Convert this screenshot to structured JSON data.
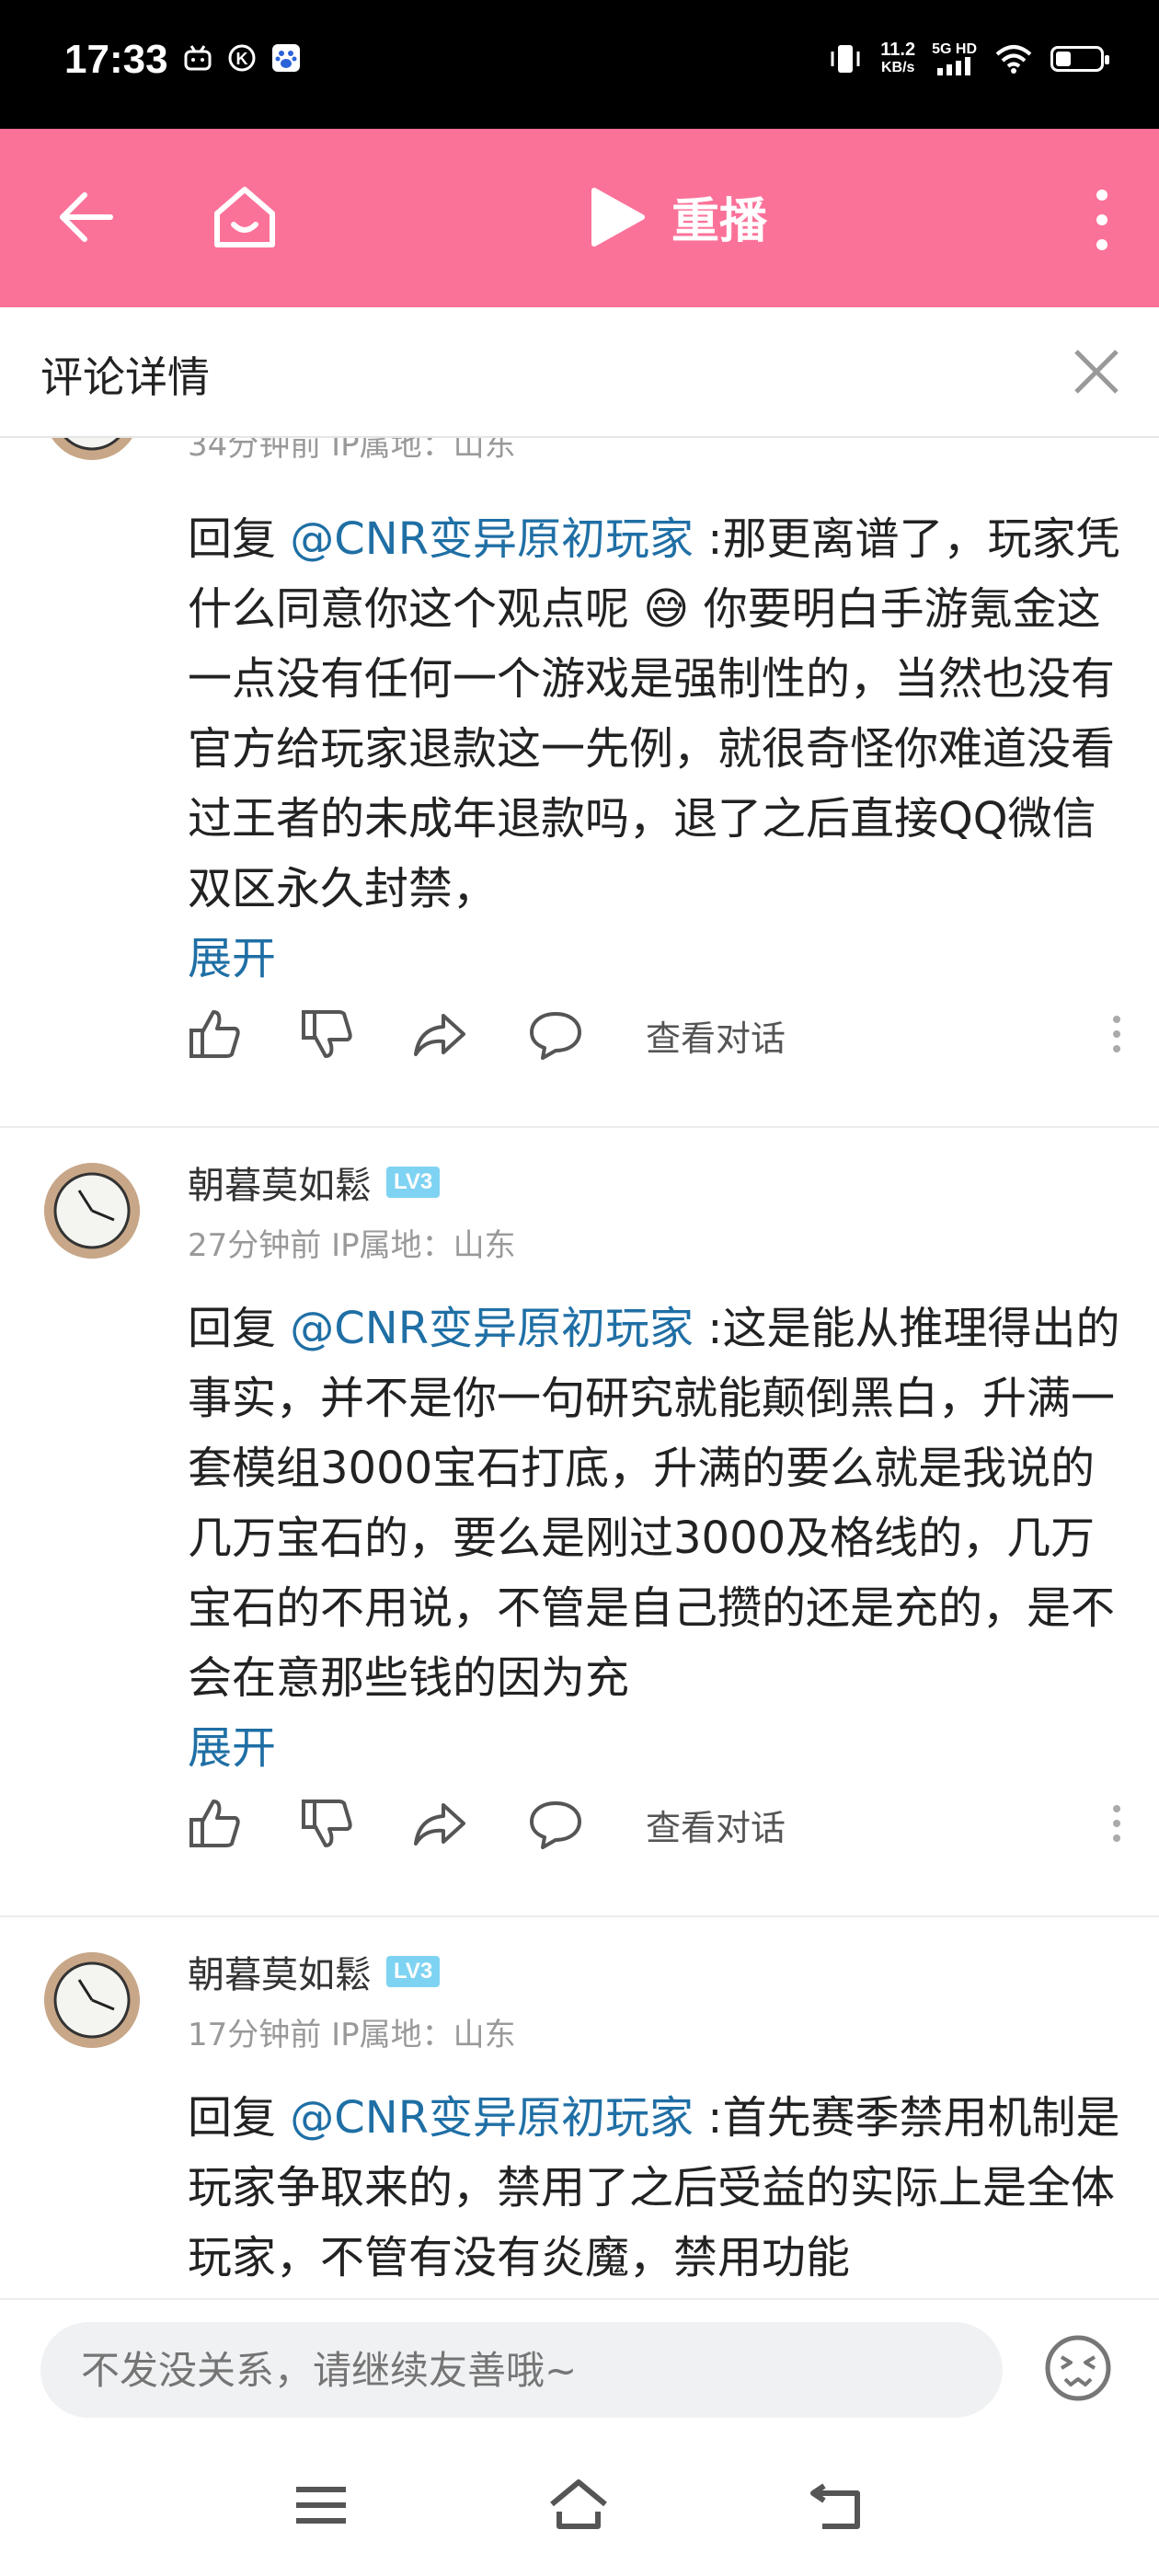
{
  "status_bar": {
    "time": "17:33",
    "left_icons": [
      "bilibili-icon",
      "k-circle-icon",
      "baidu-icon"
    ],
    "speed_value": "11.2",
    "speed_unit": "KB/s",
    "network_top": "5G HD",
    "icons": [
      "vibrate-icon",
      "signal-icon",
      "wifi-icon",
      "battery-icon"
    ],
    "battery_level": 0.34
  },
  "nav": {
    "replay_label": "重播"
  },
  "detail": {
    "title": "评论详情"
  },
  "comments": [
    {
      "meta": "34分钟前 IP属地：山东",
      "reply_prefix": "回复 ",
      "mention": "@CNR变异原初玩家",
      "text_before_emoji": " :那更离谱了，玩家凭什么同意你这个观点呢",
      "emoji": "😅",
      "text_after_emoji": " 你要明白手游氪金这一点没有任何一个游戏是强制性的，当然也没有官方给玩家退款这一先例，就很奇怪你难道没看过王者的未成年退款吗，退了之后直接QQ微信双区永久封禁，",
      "expand": "展开",
      "view_dialog": "查看对话"
    },
    {
      "username": "朝暮莫如鬆",
      "level": "LV3",
      "meta": "27分钟前 IP属地：山东",
      "reply_prefix": "回复 ",
      "mention": "@CNR变异原初玩家",
      "text": " :这是能从推理得出的事实，并不是你一句研究就能颠倒黑白，升满一套模组3000宝石打底，升满的要么就是我说的几万宝石的，要么是刚过3000及格线的，几万宝石的不用说，不管是自己攒的还是充的，是不会在意那些钱的因为充",
      "expand": "展开",
      "view_dialog": "查看对话"
    },
    {
      "username": "朝暮莫如鬆",
      "level": "LV3",
      "meta": "17分钟前 IP属地：山东",
      "reply_prefix": "回复 ",
      "mention": "@CNR变异原初玩家",
      "text": " :首先赛季禁用机制是玩家争取来的，禁用了之后受益的实际上是全体玩家，不管有没有炎魔，禁用功能"
    }
  ],
  "input": {
    "placeholder": "不发没关系，请继续友善哦~"
  },
  "colors": {
    "nav_pink": "#fb7299",
    "link_blue": "#1f6fa5",
    "level_badge": "#7fd3f2"
  }
}
